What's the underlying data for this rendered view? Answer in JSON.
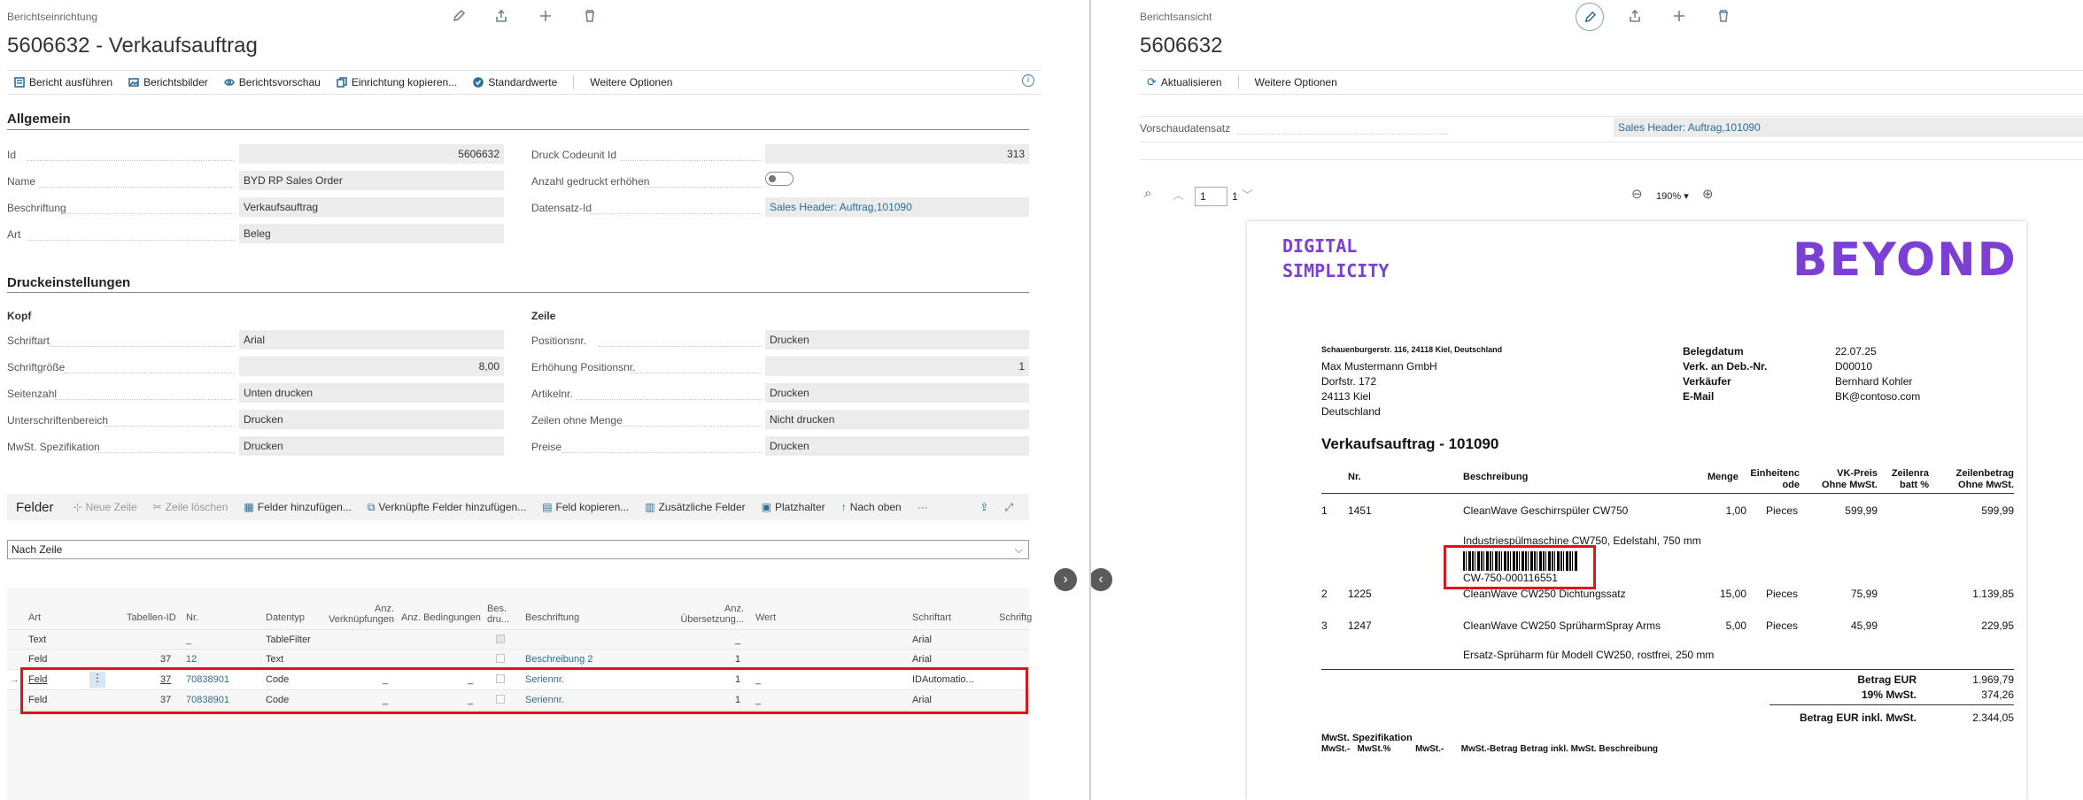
{
  "left": {
    "breadcrumb": "Berichtseinrichtung",
    "title": "5606632 - Verkaufsauftrag",
    "actions": [
      "Bericht ausführen",
      "Berichtsbilder",
      "Berichtsvorschau",
      "Einrichtung kopieren...",
      "Standardwerte",
      "Weitere Optionen"
    ],
    "general": {
      "heading": "Allgemein",
      "id_label": "Id",
      "id_value": "5606632",
      "name_label": "Name",
      "name_value": "BYD RP Sales Order",
      "caption_label": "Beschriftung",
      "caption_value": "Verkaufsauftrag",
      "type_label": "Art",
      "type_value": "Beleg",
      "print_cu_label": "Druck Codeunit Id",
      "print_cu_value": "313",
      "count_label": "Anzahl gedruckt erhöhen",
      "record_label": "Datensatz-Id",
      "record_value": "Sales Header: Auftrag,101090"
    },
    "print": {
      "heading": "Druckeinstellungen",
      "head_sub": "Kopf",
      "line_sub": "Zeile",
      "font_label": "Schriftart",
      "font_value": "Arial",
      "size_label": "Schriftgröße",
      "size_value": "8,00",
      "pagenum_label": "Seitenzahl",
      "pagenum_value": "Unten drucken",
      "sign_label": "Unterschriftenbereich",
      "sign_value": "Drucken",
      "vat_label": "MwSt. Spezifikation",
      "vat_value": "Drucken",
      "posno_label": "Positionsnr.",
      "posno_value": "Drucken",
      "posinc_label": "Erhöhung Positionsnr.",
      "posinc_value": "1",
      "item_label": "Artikelnr.",
      "item_value": "Drucken",
      "noqty_label": "Zeilen ohne Menge",
      "noqty_value": "Nicht drucken",
      "price_label": "Preise",
      "price_value": "Drucken"
    },
    "fields_part": {
      "title": "Felder",
      "actions": [
        "Neue Zeile",
        "Zeile löschen",
        "Felder hinzufügen...",
        "Verknüpfte Felder hinzufügen...",
        "Feld kopieren...",
        "Zusätzliche Felder",
        "Platzhalter",
        "Nach oben",
        "···"
      ],
      "filter_value": "Nach Zeile",
      "columns": [
        "Art",
        "Tabellen-ID",
        "Nr.",
        "Datentyp",
        "Anz. Verknüpfungen",
        "Anz. Bedingungen",
        "Bes. dru...",
        "Beschriftung",
        "Anz. Übersetzung...",
        "Wert",
        "Schriftart",
        "Schriftg"
      ],
      "rows": [
        {
          "art": "Text",
          "table": "",
          "nr": "_",
          "dtype": "TableFilter",
          "links": "",
          "conds": "",
          "caption": "",
          "trans": "_",
          "value": "",
          "font": "Arial"
        },
        {
          "art": "Feld",
          "table": "37",
          "nr": "12",
          "dtype": "Text",
          "links": "",
          "conds": "",
          "caption": "Beschreibung 2",
          "trans": "1",
          "value": "",
          "font": "Arial"
        },
        {
          "art": "Feld",
          "table": "37",
          "nr": "70838901",
          "dtype": "Code",
          "links": "_",
          "conds": "_",
          "caption": "Seriennr.",
          "trans": "1",
          "value": "_",
          "font": "IDAutomatio..."
        },
        {
          "art": "Feld",
          "table": "37",
          "nr": "70838901",
          "dtype": "Code",
          "links": "_",
          "conds": "_",
          "caption": "Seriennr.",
          "trans": "1",
          "value": "_",
          "font": "Arial"
        }
      ]
    }
  },
  "right": {
    "breadcrumb": "Berichtsansicht",
    "title": "5606632",
    "actions": [
      "Aktualisieren",
      "Weitere Optionen"
    ],
    "preview_label": "Vorschaudatensatz",
    "preview_value": "Sales Header: Auftrag,101090",
    "page_num": "1",
    "page_total": "1",
    "zoom": "190%",
    "doc": {
      "logo_line1": "DIGITAL",
      "logo_line2": "SIMPLICITY",
      "brand": "BEYOND",
      "sender": "Schauenburgerstr. 116, 24118 Kiel, Deutschland",
      "addr": [
        "Max Mustermann GmbH",
        "Dorfstr. 172",
        "24113 Kiel",
        "Deutschland"
      ],
      "meta_labels": [
        "Belegdatum",
        "Verk. an Deb.-Nr.",
        "Verkäufer",
        "E-Mail"
      ],
      "meta_values": [
        "22.07.25",
        "D00010",
        "Bernhard Kohler",
        "BK@contoso.com"
      ],
      "heading": "Verkaufsauftrag - 101090",
      "col_nr": "Nr.",
      "col_desc": "Beschreibung",
      "col_qty": "Menge",
      "col_unit": "Einheitenc ode",
      "col_price": "VK-Preis Ohne MwSt.",
      "col_disc": "Zeilenra batt %",
      "col_amt": "Zeilenbetrag Ohne MwSt.",
      "lines": [
        {
          "pos": "1",
          "nr": "1451",
          "desc": "CleanWave Geschirrspüler CW750",
          "qty": "1,00",
          "unit": "Pieces",
          "price": "599,99",
          "amt": "599,99",
          "extra": "Industriespülmaschine CW750, Edelstahl, 750 mm",
          "serial": "CW-750-000116551"
        },
        {
          "pos": "2",
          "nr": "1225",
          "desc": "CleanWave CW250 Dichtungssatz",
          "qty": "15,00",
          "unit": "Pieces",
          "price": "75,99",
          "amt": "1.139,85",
          "extra": "",
          "serial": ""
        },
        {
          "pos": "3",
          "nr": "1247",
          "desc": "CleanWave CW250  SprüharmSpray Arms",
          "qty": "5,00",
          "unit": "Pieces",
          "price": "45,99",
          "amt": "229,95",
          "extra": "Ersatz-Sprüharm für Modell CW250, rostfrei, 250 mm",
          "serial": ""
        }
      ],
      "sum_label1": "Betrag EUR",
      "sum_value1": "1.969,79",
      "sum_label2": "19% MwSt.",
      "sum_value2": "374,26",
      "sum_label3": "Betrag EUR inkl. MwSt.",
      "sum_value3": "2.344,05",
      "vat_spec": "MwSt. Spezifikation",
      "vat_cols": "MwSt.-   MwSt.%          MwSt.-       MwSt.-Betrag Betrag inkl. MwSt. Beschreibung"
    }
  },
  "colors": {
    "accent": "#2a6d97",
    "highlight": "#e0121b"
  }
}
